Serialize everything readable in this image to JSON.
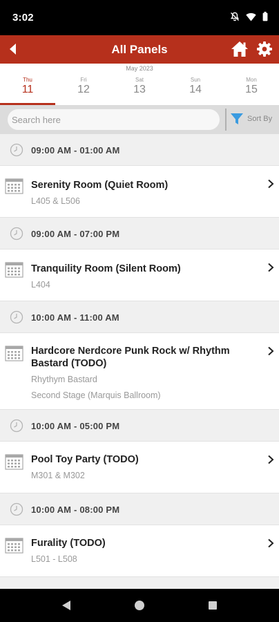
{
  "status_bar": {
    "time": "3:02"
  },
  "app_bar": {
    "title": "All Panels",
    "back_icon": "chevron-left-icon",
    "home_icon": "home-icon",
    "settings_icon": "gear-icon",
    "color": "#b6301c"
  },
  "date_bar": {
    "month": "May 2023",
    "days": [
      {
        "dow": "Thu",
        "num": "11",
        "selected": true
      },
      {
        "dow": "Fri",
        "num": "12",
        "selected": false
      },
      {
        "dow": "Sat",
        "num": "13",
        "selected": false
      },
      {
        "dow": "Sun",
        "num": "14",
        "selected": false
      },
      {
        "dow": "Mon",
        "num": "15",
        "selected": false
      }
    ]
  },
  "search": {
    "placeholder": "Search here",
    "value": ""
  },
  "sort": {
    "label": "Sort By",
    "icon": "filter-icon",
    "icon_color": "#3a9be0"
  },
  "groups": [
    {
      "time": "09:00 AM - 01:00 AM",
      "items": [
        {
          "title": "Serenity Room (Quiet Room)",
          "lines": [
            "L405 & L506"
          ]
        }
      ]
    },
    {
      "time": "09:00 AM - 07:00 PM",
      "items": [
        {
          "title": "Tranquility Room (Silent Room)",
          "lines": [
            "L404"
          ]
        }
      ]
    },
    {
      "time": "10:00 AM - 11:00 AM",
      "items": [
        {
          "title": "Hardcore Nerdcore Punk Rock w/ Rhythm Bastard (TODO)",
          "lines": [
            "Rhythym Bastard",
            "Second Stage (Marquis Ballroom)"
          ]
        }
      ]
    },
    {
      "time": "10:00 AM - 05:00 PM",
      "items": [
        {
          "title": "Pool Toy Party (TODO)",
          "lines": [
            "M301 & M302"
          ]
        }
      ]
    },
    {
      "time": "10:00 AM - 08:00 PM",
      "items": [
        {
          "title": "Furality (TODO)",
          "lines": [
            "L501 - L508"
          ]
        }
      ]
    }
  ]
}
